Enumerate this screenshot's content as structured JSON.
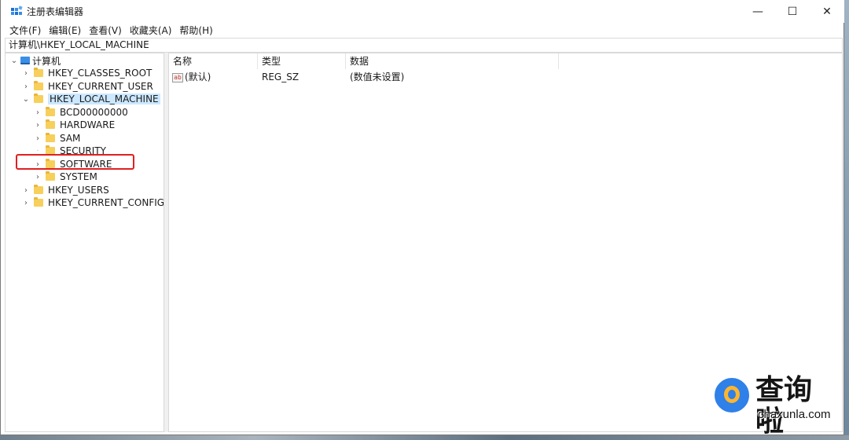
{
  "window": {
    "title": "注册表编辑器",
    "controls": {
      "minimize": "—",
      "maximize": "☐",
      "close": "✕"
    }
  },
  "menu": {
    "items": [
      "文件(F)",
      "编辑(E)",
      "查看(V)",
      "收藏夹(A)",
      "帮助(H)"
    ]
  },
  "address": "计算机\\HKEY_LOCAL_MACHINE",
  "tree": {
    "root": "计算机",
    "hives": [
      "HKEY_CLASSES_ROOT",
      "HKEY_CURRENT_USER",
      "HKEY_LOCAL_MACHINE",
      "HKEY_USERS",
      "HKEY_CURRENT_CONFIG"
    ],
    "selected": "HKEY_LOCAL_MACHINE",
    "hklm_children": [
      "BCD00000000",
      "HARDWARE",
      "SAM",
      "SECURITY",
      "SOFTWARE",
      "SYSTEM"
    ],
    "highlighted": "SOFTWARE"
  },
  "values": {
    "columns": [
      "名称",
      "类型",
      "数据"
    ],
    "rows": [
      {
        "name": "(默认)",
        "type": "REG_SZ",
        "data": "(数值未设置)",
        "icon": "ab-icon"
      }
    ]
  },
  "watermark": {
    "title": "查询啦",
    "subtitle": "chaxunla.com"
  },
  "colors": {
    "selection": "#cce8ff",
    "highlight_box": "#e02020",
    "folder": "#f7cf5b"
  }
}
